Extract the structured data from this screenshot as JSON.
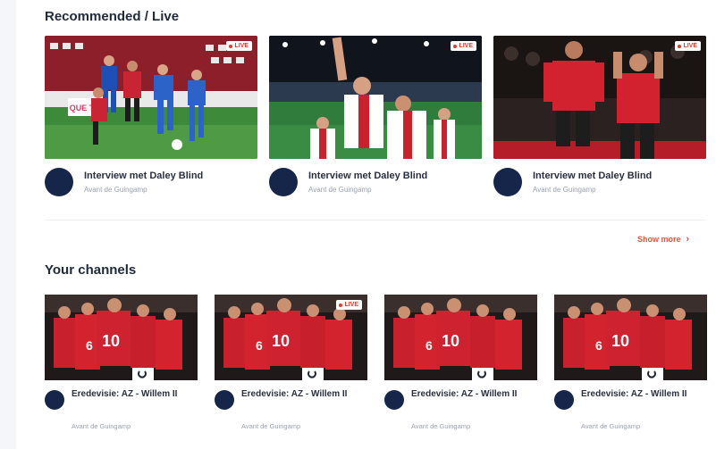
{
  "colors": {
    "accent": "#e2563c",
    "avatar": "#16254a",
    "live": "#e03a2e"
  },
  "recommended": {
    "title": "Recommended / Live",
    "cards": [
      {
        "live_label": "LIVE",
        "title": "Interview met Daley Blind",
        "subtitle": "Avant de Guingamp",
        "ad_text": "QUE TIC"
      },
      {
        "live_label": "LIVE",
        "title": "Interview met Daley Blind",
        "subtitle": "Avant de Guingamp"
      },
      {
        "live_label": "LIVE",
        "title": "Interview met Daley Blind",
        "subtitle": "Avant de Guingamp"
      }
    ],
    "show_more": "Show more",
    "show_more_icon": "chevron-right-icon"
  },
  "channels": {
    "title": "Your channels",
    "cards": [
      {
        "title": "Eredevisie: AZ - Willem II",
        "subtitle": "Avant de Guingamp",
        "shirt_numbers": [
          "6",
          "10"
        ]
      },
      {
        "live_label": "LIVE",
        "title": "Eredevisie: AZ - Willem II",
        "subtitle": "Avant de Guingamp",
        "shirt_numbers": [
          "6",
          "10"
        ]
      },
      {
        "title": "Eredevisie: AZ - Willem II",
        "subtitle": "Avant de Guingamp",
        "shirt_numbers": [
          "6",
          "10"
        ]
      },
      {
        "title": "Eredevisie: AZ - Willem II",
        "subtitle": "Avant de Guingamp",
        "shirt_numbers": [
          "6",
          "10"
        ]
      }
    ]
  }
}
